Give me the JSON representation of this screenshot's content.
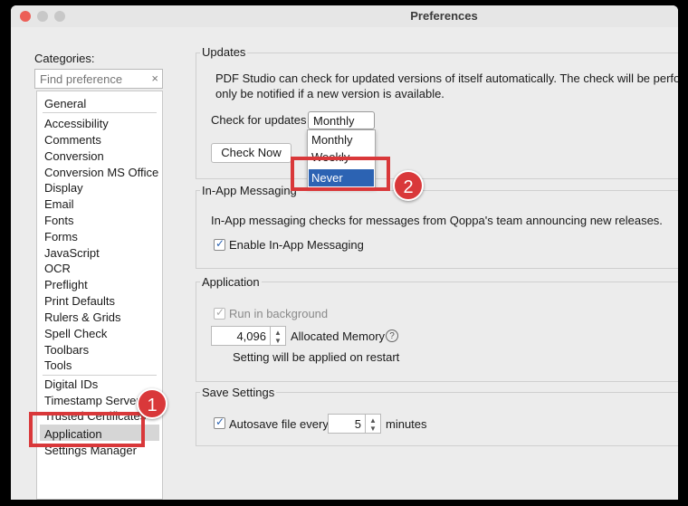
{
  "window": {
    "title": "Preferences"
  },
  "sidebar": {
    "categories_label": "Categories:",
    "search_placeholder": "Find preference",
    "items": [
      "General",
      "Accessibility",
      "Comments",
      "Conversion",
      "Conversion MS Office",
      "Display",
      "Email",
      "Fonts",
      "Forms",
      "JavaScript",
      "OCR",
      "Preflight",
      "Print Defaults",
      "Rulers & Grids",
      "Spell Check",
      "Toolbars",
      "Tools",
      "Digital IDs",
      "Timestamp Servers",
      "Trusted Certificates",
      "Application",
      "Settings Manager"
    ],
    "selected": "Application"
  },
  "updates": {
    "group_label": "Updates",
    "description_line1": "PDF Studio can check for updated versions of itself automatically. The check will be performed",
    "description_line2": "only be notified if a new version is available.",
    "check_label": "Check for updates",
    "check_value": "Monthly",
    "options": [
      "Monthly",
      "Weekly",
      "Never"
    ],
    "highlighted_option": "Never",
    "check_now_label": "Check Now"
  },
  "messaging": {
    "group_label": "In-App Messaging",
    "description": "In-App messaging checks for messages from Qoppa's team announcing new releases.",
    "enable_label": "Enable In-App Messaging",
    "enabled": true
  },
  "application": {
    "group_label": "Application",
    "run_bg_label": "Run in background",
    "memory_value": "4,096",
    "memory_label": "Allocated Memory",
    "restart_note": "Setting will be applied on restart"
  },
  "save_settings": {
    "group_label": "Save Settings",
    "autosave_label": "Autosave file every",
    "autosave_value": "5",
    "minutes_label": "minutes"
  },
  "annotations": {
    "step1": "1",
    "step2": "2"
  },
  "colors": {
    "highlight": "#d9383a",
    "selection": "#2c63b3"
  }
}
